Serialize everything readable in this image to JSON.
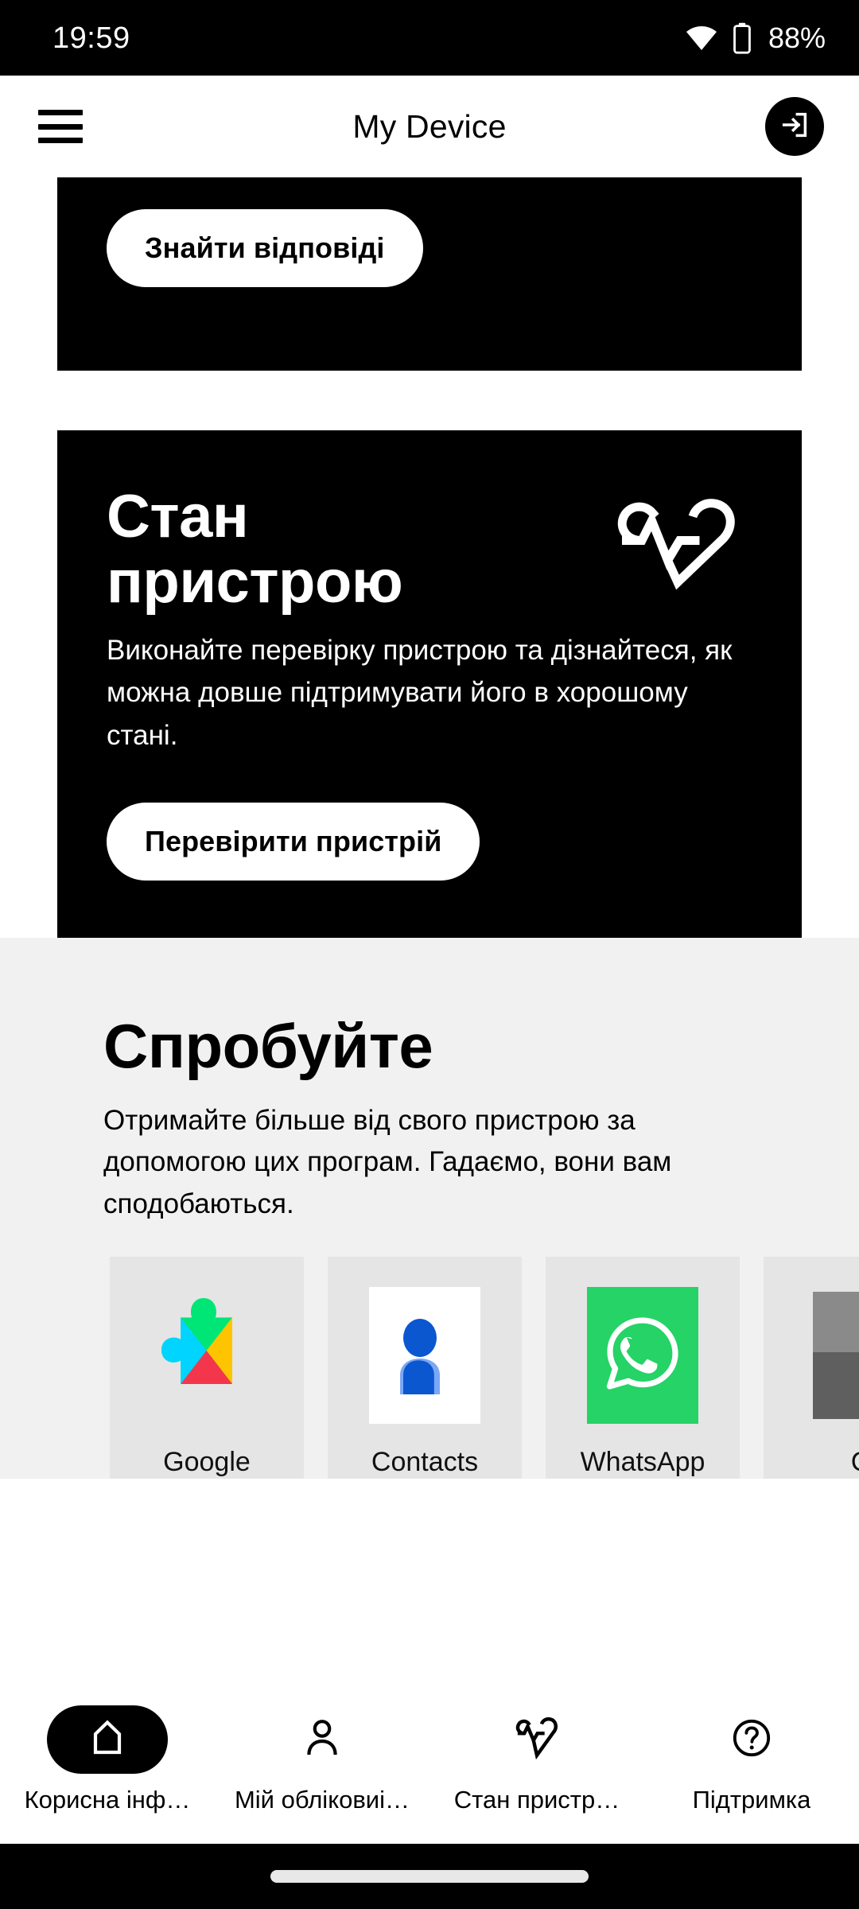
{
  "status_bar": {
    "time": "19:59",
    "battery_percent": "88%",
    "wifi_icon": "wifi-icon",
    "battery_icon": "battery-icon"
  },
  "header": {
    "title": "My Device",
    "menu_icon": "hamburger-menu-icon",
    "login_icon": "login-icon"
  },
  "promo_card": {
    "button_label": "Знайти відповіді"
  },
  "health_card": {
    "title": "Стан пристрою",
    "icon": "heart-pulse-icon",
    "description": "Виконайте перевірку пристрою та дізнайтеся, як можна довше підтримувати його в хорошому стані.",
    "button_label": "Перевірити пристрій"
  },
  "try_section": {
    "title": "Спробуйте",
    "description": "Отримайте більше від свого пристрою за допомогою цих програм. Гадаємо, вони вам сподобаються.",
    "apps": [
      {
        "label": "Google",
        "icon": "google-play-services-icon"
      },
      {
        "label": "Contacts",
        "icon": "contacts-icon"
      },
      {
        "label": "WhatsApp",
        "icon": "whatsapp-icon"
      },
      {
        "label": "C",
        "icon": "calculator-icon"
      }
    ]
  },
  "bottom_nav": {
    "items": [
      {
        "label": "Корисна інф…",
        "icon": "home-icon",
        "active": true
      },
      {
        "label": "Мій обліковиі…",
        "icon": "person-icon",
        "active": false
      },
      {
        "label": "Стан пристр…",
        "icon": "heart-pulse-icon",
        "active": false
      },
      {
        "label": "Підтримка",
        "icon": "help-circle-icon",
        "active": false
      }
    ]
  },
  "colors": {
    "accent_black": "#000000",
    "page_white": "#ffffff",
    "section_grey": "#f1f1f1",
    "tile_grey": "#e5e5e5",
    "whatsapp_green": "#25d366",
    "contacts_blue": "#1a73e8"
  }
}
